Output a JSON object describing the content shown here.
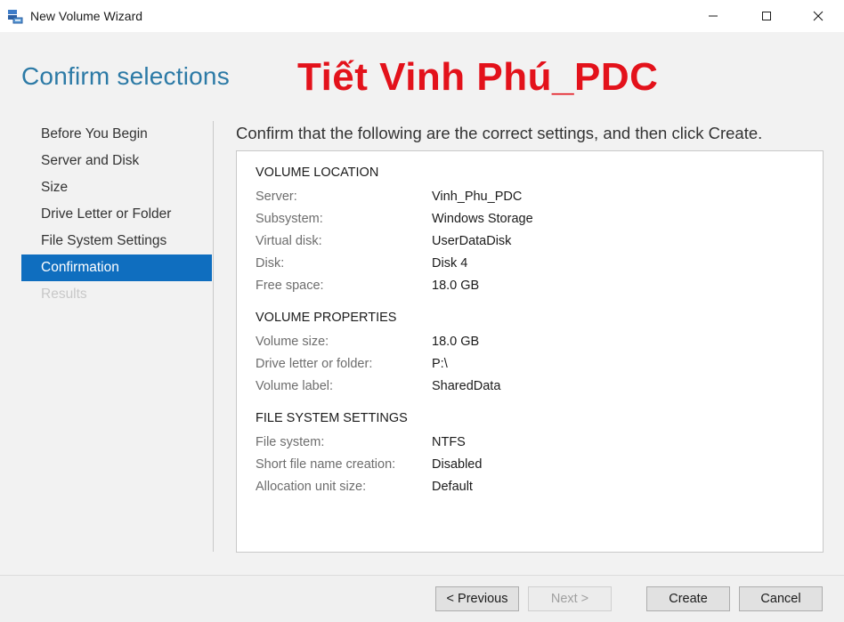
{
  "window": {
    "title": "New Volume Wizard",
    "icon": "volume-wizard-icon"
  },
  "header": {
    "title": "Confirm selections",
    "watermark": "Tiết Vinh Phú_PDC"
  },
  "nav": {
    "items": [
      {
        "label": "Before You Begin",
        "state": "normal"
      },
      {
        "label": "Server and Disk",
        "state": "normal"
      },
      {
        "label": "Size",
        "state": "normal"
      },
      {
        "label": "Drive Letter or Folder",
        "state": "normal"
      },
      {
        "label": "File System Settings",
        "state": "normal"
      },
      {
        "label": "Confirmation",
        "state": "active"
      },
      {
        "label": "Results",
        "state": "disabled"
      }
    ]
  },
  "main": {
    "instruction": "Confirm that the following are the correct settings, and then click Create.",
    "sections": [
      {
        "title": "VOLUME LOCATION",
        "rows": [
          {
            "key": "Server:",
            "value": "Vinh_Phu_PDC"
          },
          {
            "key": "Subsystem:",
            "value": "Windows Storage"
          },
          {
            "key": "Virtual disk:",
            "value": "UserDataDisk"
          },
          {
            "key": "Disk:",
            "value": "Disk 4"
          },
          {
            "key": "Free space:",
            "value": "18.0 GB"
          }
        ]
      },
      {
        "title": "VOLUME PROPERTIES",
        "rows": [
          {
            "key": "Volume size:",
            "value": "18.0 GB"
          },
          {
            "key": "Drive letter or folder:",
            "value": "P:\\"
          },
          {
            "key": "Volume label:",
            "value": "SharedData"
          }
        ]
      },
      {
        "title": "FILE SYSTEM SETTINGS",
        "rows": [
          {
            "key": "File system:",
            "value": "NTFS"
          },
          {
            "key": "Short file name creation:",
            "value": "Disabled"
          },
          {
            "key": "Allocation unit size:",
            "value": "Default"
          }
        ]
      }
    ]
  },
  "footer": {
    "previous_label": "< Previous",
    "next_label": "Next >",
    "create_label": "Create",
    "cancel_label": "Cancel"
  },
  "colors": {
    "accent": "#0f6ebf",
    "heading": "#2c7aa6",
    "watermark": "#e3121b"
  }
}
